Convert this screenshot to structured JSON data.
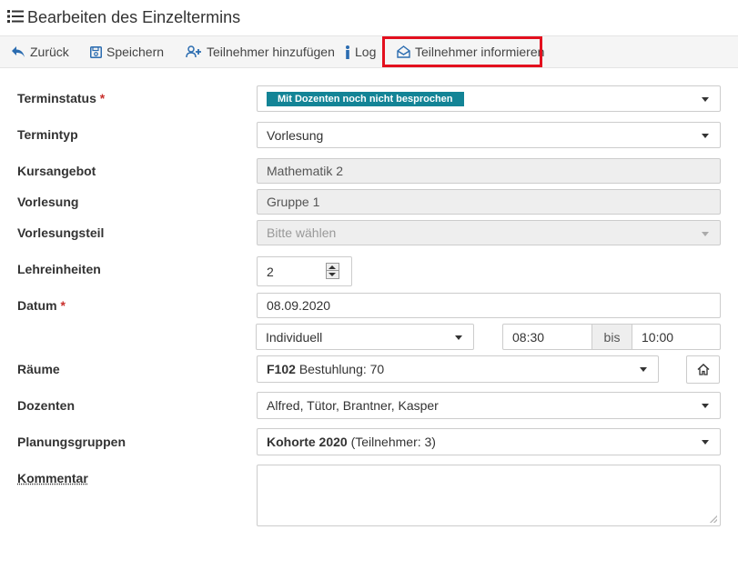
{
  "header": {
    "title": "Bearbeiten des Einzeltermins"
  },
  "toolbar": {
    "back_label": "Zurück",
    "save_label": "Speichern",
    "add_participant_label": "Teilnehmer hinzufügen",
    "log_label": "Log",
    "inform_label": "Teilnehmer informieren",
    "highlight_color": "#e3101e"
  },
  "form": {
    "terminstatus": {
      "label": "Terminstatus",
      "required_mark": "*",
      "value": "Mit Dozenten noch nicht besprochen",
      "badge_color": "#138496"
    },
    "termintyp": {
      "label": "Termintyp",
      "value": "Vorlesung"
    },
    "kursangebot": {
      "label": "Kursangebot",
      "value": "Mathematik 2"
    },
    "vorlesung": {
      "label": "Vorlesung",
      "value": "Gruppe 1"
    },
    "vorlesungsteil": {
      "label": "Vorlesungsteil",
      "placeholder": "Bitte wählen"
    },
    "lehreinheiten": {
      "label": "Lehreinheiten",
      "value": "2"
    },
    "datum": {
      "label": "Datum",
      "required_mark": "*",
      "value": "08.09.2020",
      "mode": "Individuell",
      "time_from": "08:30",
      "separator": "bis",
      "time_to": "10:00"
    },
    "raeume": {
      "label": "Räume",
      "room_code": "F102",
      "room_detail": "Bestuhlung: 70"
    },
    "dozenten": {
      "label": "Dozenten",
      "value": "Alfred, Tütor, Brantner, Kasper"
    },
    "planungsgruppen": {
      "label": "Planungsgruppen",
      "group_name": "Kohorte 2020",
      "group_detail": "(Teilnehmer: 3)"
    },
    "kommentar": {
      "label": "Kommentar",
      "value": ""
    }
  }
}
